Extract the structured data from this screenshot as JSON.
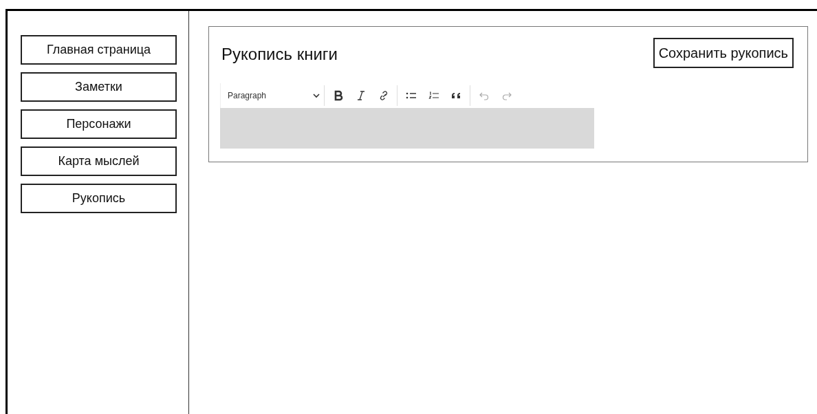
{
  "sidebar": {
    "items": [
      {
        "label": "Главная страница"
      },
      {
        "label": "Заметки"
      },
      {
        "label": "Персонажи"
      },
      {
        "label": "Карта мыслей"
      },
      {
        "label": "Рукопись"
      }
    ]
  },
  "editor_card": {
    "title": "Рукопись книги",
    "save_button": "Сохранить рукопись",
    "toolbar": {
      "format": "Paragraph",
      "groups": [
        [
          {
            "kind": "bold",
            "disabled": false
          },
          {
            "kind": "italic",
            "disabled": false
          },
          {
            "kind": "link",
            "disabled": false
          }
        ],
        [
          {
            "kind": "bulleted-list",
            "disabled": false
          },
          {
            "kind": "numbered-list",
            "disabled": false
          },
          {
            "kind": "quote",
            "disabled": false
          }
        ],
        [
          {
            "kind": "undo",
            "disabled": true
          },
          {
            "kind": "redo",
            "disabled": true
          }
        ]
      ]
    }
  }
}
